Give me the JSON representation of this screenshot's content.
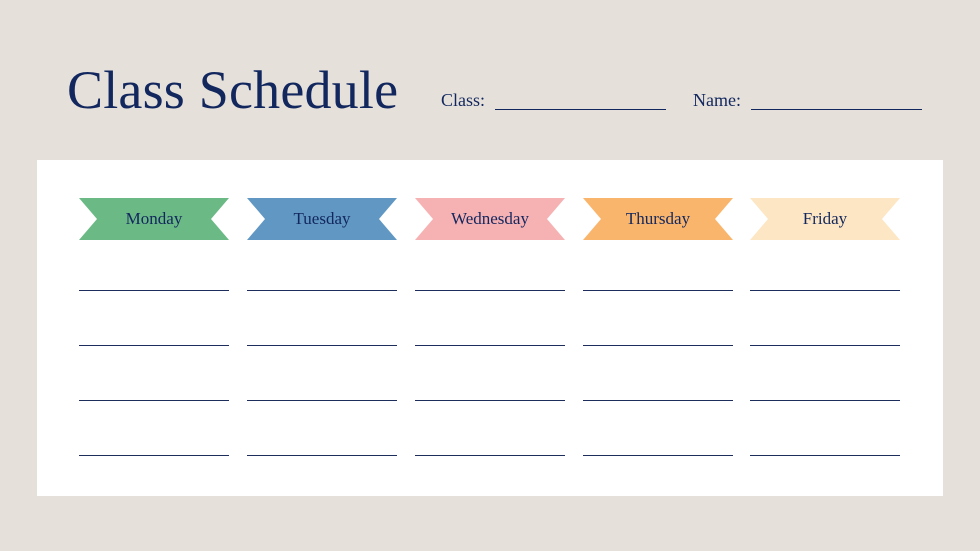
{
  "header": {
    "title": "Class Schedule",
    "class_label": "Class:",
    "class_value": "",
    "name_label": "Name:",
    "name_value": ""
  },
  "days": [
    {
      "label": "Monday",
      "color": "#6bb985"
    },
    {
      "label": "Tuesday",
      "color": "#6197c3"
    },
    {
      "label": "Wednesday",
      "color": "#f6b1b3"
    },
    {
      "label": "Thursday",
      "color": "#fab56c"
    },
    {
      "label": "Friday",
      "color": "#fde6c3"
    }
  ],
  "rows_per_day": 4,
  "colors": {
    "background": "#e5e0da",
    "panel": "#ffffff",
    "text": "#12275e"
  }
}
